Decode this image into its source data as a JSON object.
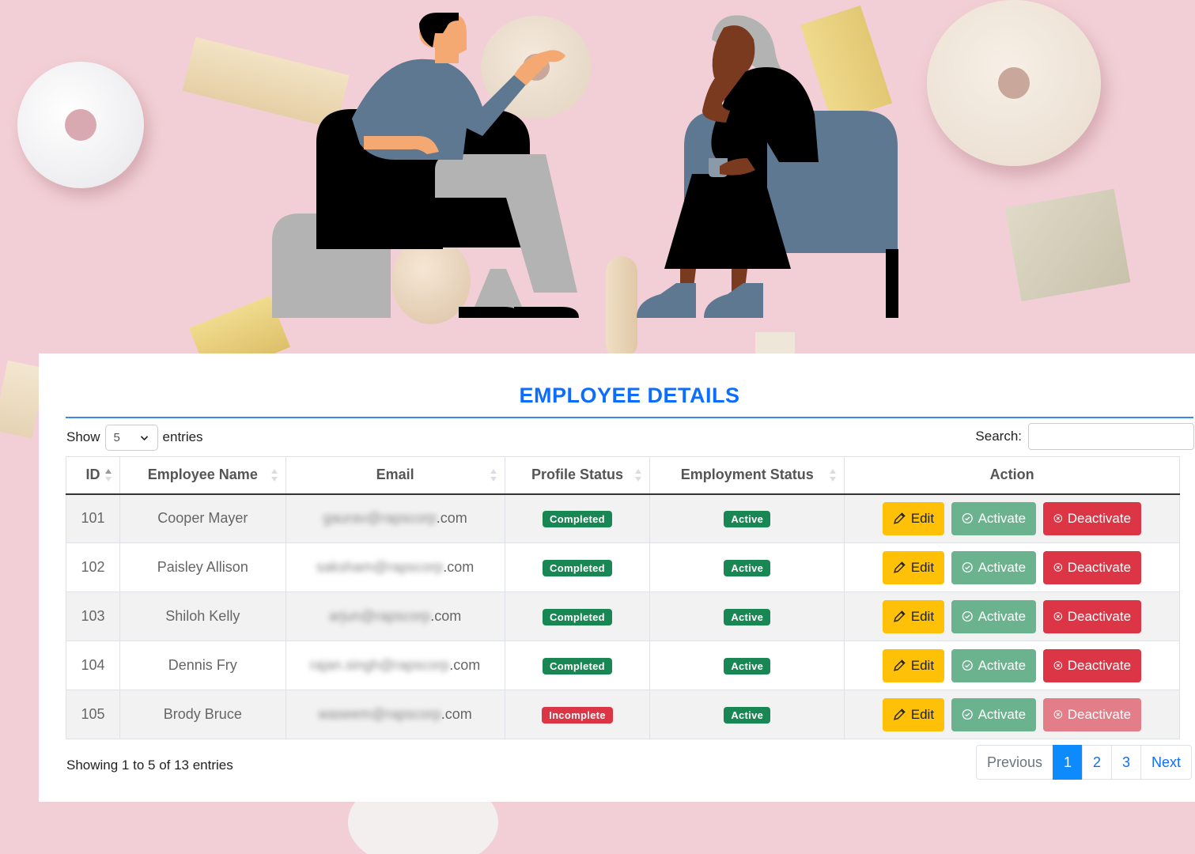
{
  "header": {
    "title": "EMPLOYEE DETAILS"
  },
  "length_menu": {
    "show_label": "Show",
    "value": "5",
    "entries_label": "entries"
  },
  "search": {
    "label": "Search:",
    "value": ""
  },
  "table": {
    "columns": [
      "ID",
      "Employee Name",
      "Email",
      "Profile Status",
      "Employment Status",
      "Action"
    ],
    "rows": [
      {
        "id": "101",
        "name": "Cooper Mayer",
        "email_local": "gaurav@rapscorp",
        "email_tld": ".com",
        "profile_status": "Completed",
        "employment_status": "Active"
      },
      {
        "id": "102",
        "name": "Paisley Allison",
        "email_local": "saksham@rapscorp",
        "email_tld": ".com",
        "profile_status": "Completed",
        "employment_status": "Active"
      },
      {
        "id": "103",
        "name": "Shiloh Kelly",
        "email_local": "arjun@rapscorp",
        "email_tld": ".com",
        "profile_status": "Completed",
        "employment_status": "Active"
      },
      {
        "id": "104",
        "name": "Dennis Fry",
        "email_local": "rajan.singh@rapscorp",
        "email_tld": ".com",
        "profile_status": "Completed",
        "employment_status": "Active"
      },
      {
        "id": "105",
        "name": "Brody Bruce",
        "email_local": "waseem@rapscorp",
        "email_tld": ".com",
        "profile_status": "Incomplete",
        "employment_status": "Active"
      }
    ],
    "actions": {
      "edit": "Edit",
      "activate": "Activate",
      "deactivate": "Deactivate"
    }
  },
  "footer": {
    "info": "Showing 1 to 5 of 13 entries",
    "pagination": {
      "previous": "Previous",
      "pages": [
        "1",
        "2",
        "3"
      ],
      "current": "1",
      "next": "Next"
    }
  },
  "colors": {
    "accent": "#0d6efd",
    "badge_success": "#198754",
    "badge_danger": "#dc3545",
    "edit": "#ffc107",
    "activate": "#6bb38e",
    "deactivate": "#dc3545",
    "background": "#f2cfd6"
  },
  "icons": {
    "edit": "pencil-icon",
    "activate": "check-circle-icon",
    "deactivate": "x-circle-icon",
    "sort": "sort-icon",
    "select": "chevron-down-icon"
  }
}
